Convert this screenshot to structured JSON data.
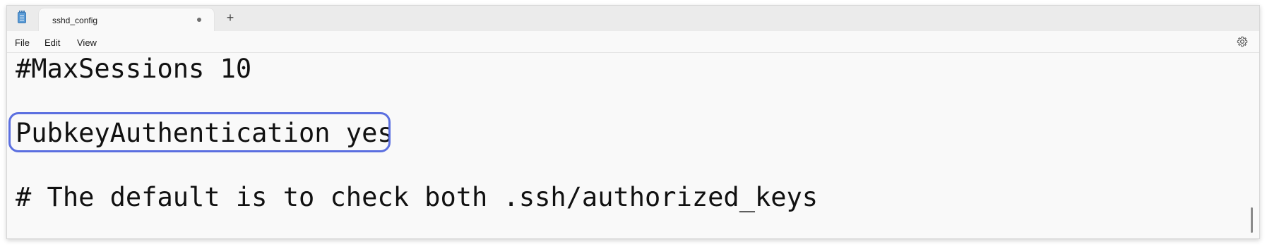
{
  "tab": {
    "title": "sshd_config",
    "new_tab_label": "+"
  },
  "menu": {
    "file": "File",
    "edit": "Edit",
    "view": "View"
  },
  "editor": {
    "lines": [
      "#MaxSessions 10",
      "PubkeyAuthentication yes",
      "# The default is to check both .ssh/authorized_keys"
    ]
  },
  "icons": {
    "app": "notepad-icon",
    "settings": "gear-icon",
    "unsaved": "unsaved-dot-icon"
  },
  "colors": {
    "highlight": "#5b6fe0"
  }
}
